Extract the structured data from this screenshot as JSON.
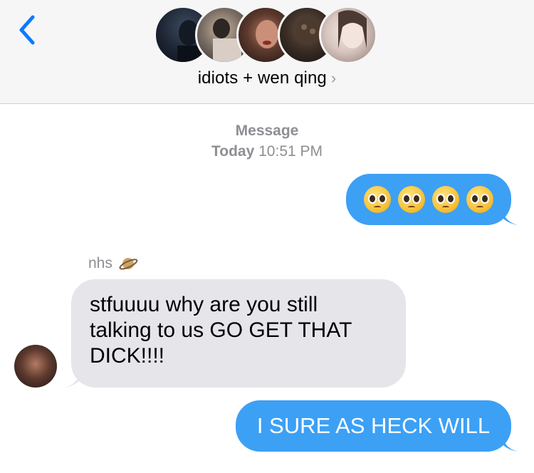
{
  "header": {
    "back_icon": "chevron-left-icon",
    "group_name": "idiots + wen qing",
    "chevron": "›",
    "avatars": [
      "avatar-1",
      "avatar-2",
      "avatar-3",
      "avatar-4",
      "avatar-5"
    ]
  },
  "thread_meta": {
    "service": "Message",
    "day": "Today",
    "time": "10:51 PM"
  },
  "messages": [
    {
      "direction": "outgoing",
      "emoji": "🥺🥺🥺🥺"
    },
    {
      "direction": "incoming",
      "sender": "nhs",
      "sender_emoji": "🪐",
      "lines": [
        "stfuuuu why are you still",
        "talking to us GO GET THAT",
        "DICK!!!!"
      ]
    },
    {
      "direction": "outgoing",
      "text": "I SURE AS HECK WILL"
    }
  ],
  "colors": {
    "outgoing_bubble": "#3ca0f5",
    "incoming_bubble": "#e5e5ea",
    "accent": "#0a7aff"
  }
}
